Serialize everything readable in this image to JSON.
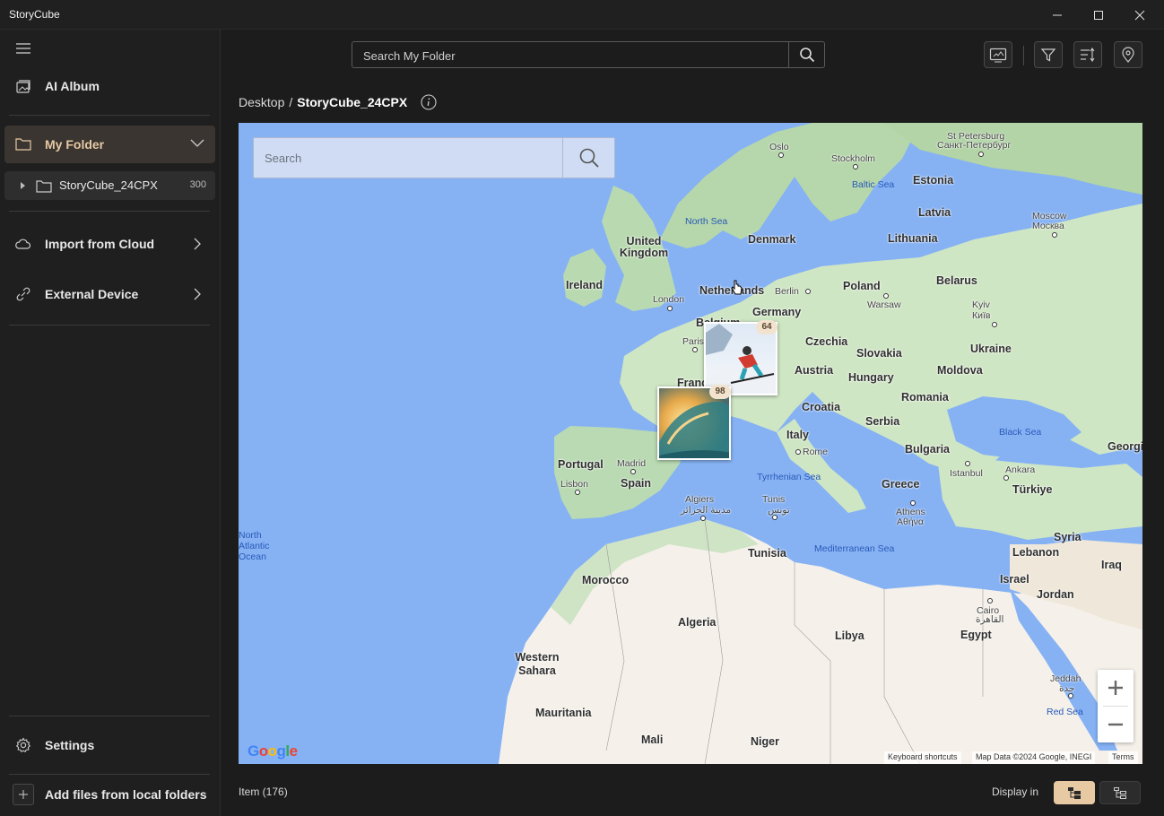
{
  "app": {
    "title": "StoryCube"
  },
  "sidebar": {
    "ai_album": "AI Album",
    "my_folder": "My Folder",
    "subfolder": {
      "name": "StoryCube_24CPX",
      "count": "300"
    },
    "import_cloud": "Import from Cloud",
    "external_device": "External Device",
    "settings": "Settings",
    "add_local": "Add files from local folders"
  },
  "toolbar": {
    "search_placeholder": "Search My Folder"
  },
  "breadcrumb": {
    "root": "Desktop",
    "sep": "/",
    "current": "StoryCube_24CPX"
  },
  "map": {
    "search_placeholder": "Search",
    "clusters": [
      {
        "count": "64",
        "subject": "skier"
      },
      {
        "count": "98",
        "subject": "ocean-wave"
      }
    ],
    "countries": [
      "United Kingdom",
      "Ireland",
      "Netherlands",
      "Denmark",
      "Germany",
      "Poland",
      "Belarus",
      "Lithuania",
      "Latvia",
      "Estonia",
      "Czechia",
      "Slovakia",
      "Austria",
      "Hungary",
      "Ukraine",
      "Moldova",
      "Romania",
      "Croatia",
      "Serbia",
      "Bulgaria",
      "Italy",
      "Greece",
      "Türkiye",
      "Georgia",
      "Portugal",
      "Spain",
      "Morocco",
      "Algeria",
      "Tunisia",
      "Libya",
      "Egypt",
      "Western Sahara",
      "Mauritania",
      "Mali",
      "Niger",
      "Syria",
      "Lebanon",
      "Israel",
      "Jordan",
      "Iraq",
      "Belgium",
      "France"
    ],
    "cities": [
      "Oslo",
      "Stockholm",
      "St Petersburg",
      "Санкт-Петербург",
      "Moscow",
      "Москва",
      "London",
      "Berlin",
      "Warsaw",
      "Paris",
      "Kyiv",
      "Київ",
      "Madrid",
      "Lisbon",
      "Rome",
      "Istanbul",
      "Ankara",
      "Athens",
      "Αθήνα",
      "Algiers",
      "مدينة الجزائر",
      "Tunis",
      "تونس",
      "Cairo",
      "القاهرة",
      "Jeddah",
      "جدة"
    ],
    "seas": [
      "North Sea",
      "Baltic Sea",
      "Black Sea",
      "Tyrrhenian Sea",
      "Mediterranean Sea",
      "Red Sea",
      "North Atlantic Ocean"
    ],
    "attribution": {
      "shortcuts": "Keyboard shortcuts",
      "data": "Map Data ©2024 Google, INEGI",
      "terms": "Terms"
    },
    "logo": "Google"
  },
  "footer": {
    "items": "Item (176)",
    "display_in": "Display in"
  }
}
